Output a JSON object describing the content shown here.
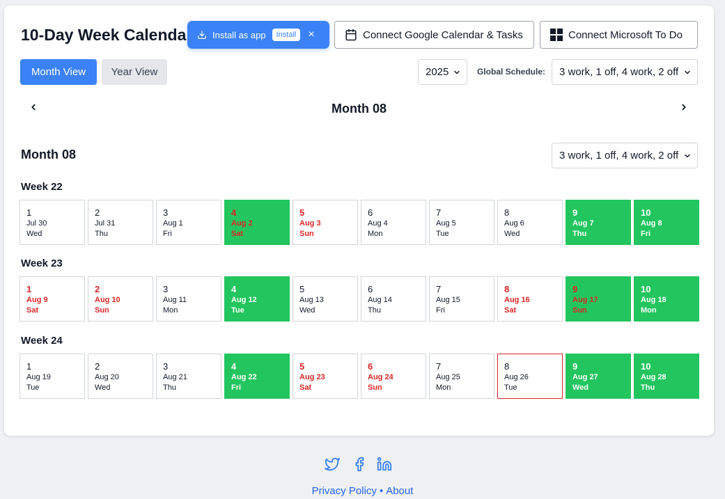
{
  "header": {
    "title": "10-Day Week Calendar",
    "install_banner": {
      "label": "Install as app",
      "button": "Install",
      "close": "×"
    },
    "connect_google": "Connect Google Calendar & Tasks",
    "connect_microsoft": "Connect Microsoft To Do"
  },
  "view_tabs": {
    "month": "Month View",
    "year": "Year View"
  },
  "year_select": {
    "value": "2025"
  },
  "global_schedule": {
    "label": "Global Schedule:",
    "value": "3 work, 1 off, 4 work, 2 off"
  },
  "navigation": {
    "current": "Month 08"
  },
  "month_section": {
    "title": "Month 08",
    "schedule_value": "3 work, 1 off, 4 work, 2 off"
  },
  "weeks": [
    {
      "label": "Week 22",
      "days": [
        {
          "num": "1",
          "date": "Jul 30",
          "dow": "Wed",
          "off": false,
          "work": false
        },
        {
          "num": "2",
          "date": "Jul 31",
          "dow": "Thu",
          "off": false,
          "work": false
        },
        {
          "num": "3",
          "date": "Aug 1",
          "dow": "Fri",
          "off": false,
          "work": false
        },
        {
          "num": "4",
          "date": "Aug 2",
          "dow": "Sat",
          "off": true,
          "work": true
        },
        {
          "num": "5",
          "date": "Aug 3",
          "dow": "Sun",
          "off": true,
          "work": false
        },
        {
          "num": "6",
          "date": "Aug 4",
          "dow": "Mon",
          "off": false,
          "work": false
        },
        {
          "num": "7",
          "date": "Aug 5",
          "dow": "Tue",
          "off": false,
          "work": false
        },
        {
          "num": "8",
          "date": "Aug 6",
          "dow": "Wed",
          "off": false,
          "work": false
        },
        {
          "num": "9",
          "date": "Aug 7",
          "dow": "Thu",
          "off": false,
          "work": true
        },
        {
          "num": "10",
          "date": "Aug 8",
          "dow": "Fri",
          "off": false,
          "work": true
        }
      ]
    },
    {
      "label": "Week 23",
      "days": [
        {
          "num": "1",
          "date": "Aug 9",
          "dow": "Sat",
          "off": true,
          "work": false
        },
        {
          "num": "2",
          "date": "Aug 10",
          "dow": "Sun",
          "off": true,
          "work": false
        },
        {
          "num": "3",
          "date": "Aug 11",
          "dow": "Mon",
          "off": false,
          "work": false
        },
        {
          "num": "4",
          "date": "Aug 12",
          "dow": "Tue",
          "off": false,
          "work": true
        },
        {
          "num": "5",
          "date": "Aug 13",
          "dow": "Wed",
          "off": false,
          "work": false
        },
        {
          "num": "6",
          "date": "Aug 14",
          "dow": "Thu",
          "off": false,
          "work": false
        },
        {
          "num": "7",
          "date": "Aug 15",
          "dow": "Fri",
          "off": false,
          "work": false
        },
        {
          "num": "8",
          "date": "Aug 16",
          "dow": "Sat",
          "off": true,
          "work": false
        },
        {
          "num": "9",
          "date": "Aug 17",
          "dow": "Sun",
          "off": true,
          "work": true
        },
        {
          "num": "10",
          "date": "Aug 18",
          "dow": "Mon",
          "off": false,
          "work": true
        }
      ]
    },
    {
      "label": "Week 24",
      "days": [
        {
          "num": "1",
          "date": "Aug 19",
          "dow": "Tue",
          "off": false,
          "work": false
        },
        {
          "num": "2",
          "date": "Aug 20",
          "dow": "Wed",
          "off": false,
          "work": false
        },
        {
          "num": "3",
          "date": "Aug 21",
          "dow": "Thu",
          "off": false,
          "work": false
        },
        {
          "num": "4",
          "date": "Aug 22",
          "dow": "Fri",
          "off": false,
          "work": true
        },
        {
          "num": "5",
          "date": "Aug 23",
          "dow": "Sat",
          "off": true,
          "work": false
        },
        {
          "num": "6",
          "date": "Aug 24",
          "dow": "Sun",
          "off": true,
          "work": false
        },
        {
          "num": "7",
          "date": "Aug 25",
          "dow": "Mon",
          "off": false,
          "work": false
        },
        {
          "num": "8",
          "date": "Aug 26",
          "dow": "Tue",
          "off": false,
          "work": false,
          "today": true
        },
        {
          "num": "9",
          "date": "Aug 27",
          "dow": "Wed",
          "off": false,
          "work": true
        },
        {
          "num": "10",
          "date": "Aug 28",
          "dow": "Thu",
          "off": false,
          "work": true
        }
      ]
    }
  ],
  "footer": {
    "social_icons": [
      "twitter-icon",
      "facebook-icon",
      "linkedin-icon"
    ],
    "privacy": "Privacy Policy",
    "separator": "•",
    "about": "About"
  },
  "colors": {
    "accent": "#3b82f6",
    "work_day": "#22c55e",
    "off_day_text": "#dc2626",
    "link": "#2563eb"
  }
}
